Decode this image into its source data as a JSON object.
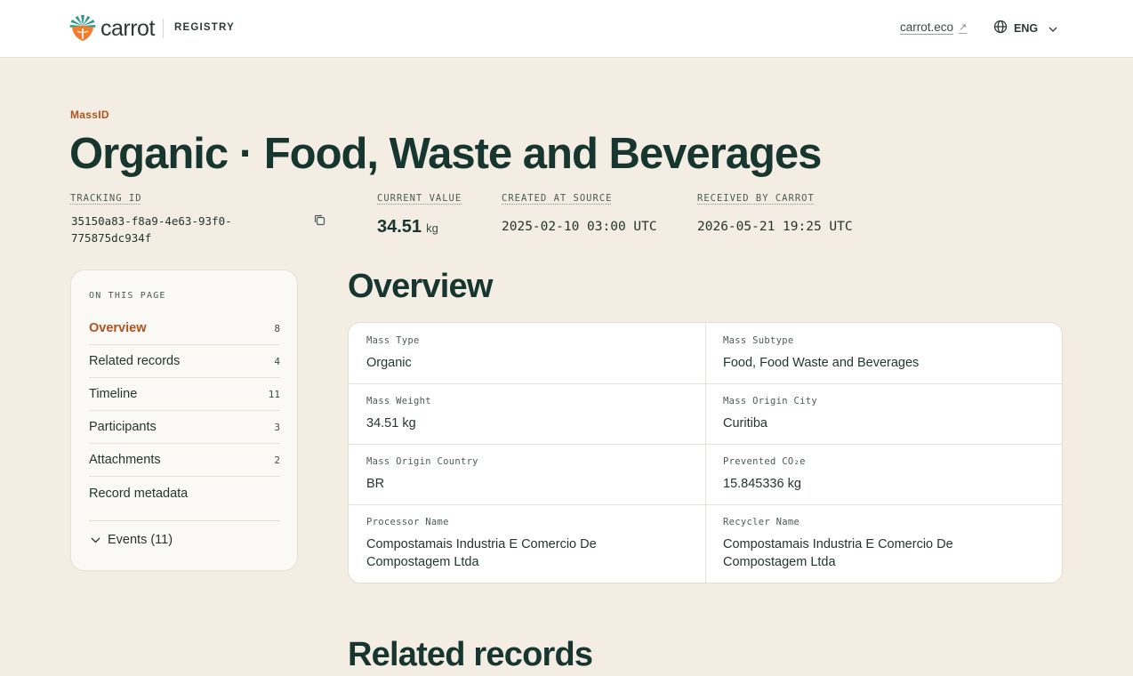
{
  "header": {
    "logo_text": "carrot",
    "logo_icon": "carrot-logo-icon",
    "section": "REGISTRY",
    "external_link": "carrot.eco",
    "external_icon": "arrow-up-right-icon",
    "language": "ENG",
    "language_icon": "globe-icon"
  },
  "record": {
    "eyebrow": "MassID",
    "title": "Organic · Food, Waste and Beverages",
    "tracking_id_label": "TRACKING ID",
    "tracking_id": "35150a83-f8a9-4e63-93f0-775875dc934f",
    "current_value_label": "CURRENT VALUE",
    "current_value": "34.51",
    "current_unit": "kg",
    "created_label": "CREATED AT SOURCE",
    "created_value": "2025-02-10 03:00 UTC",
    "received_label": "RECEIVED BY CARROT",
    "received_value": "2026-05-21 19:25 UTC"
  },
  "toc": {
    "heading": "ON THIS PAGE",
    "items": [
      {
        "label": "Overview",
        "count": "8"
      },
      {
        "label": "Related records",
        "count": "4"
      },
      {
        "label": "Timeline",
        "count": "11"
      },
      {
        "label": "Participants",
        "count": "3"
      },
      {
        "label": "Attachments",
        "count": "2"
      },
      {
        "label": "Record metadata",
        "count": ""
      }
    ],
    "events_label": "Events (11)"
  },
  "overview": {
    "title": "Overview",
    "fields": [
      {
        "label": "Mass Type",
        "value": "Organic"
      },
      {
        "label": "Mass Subtype",
        "value": "Food, Food Waste and Beverages"
      },
      {
        "label": "Mass Weight",
        "value": "34.51 kg"
      },
      {
        "label": "Mass Origin City",
        "value": "Curitiba"
      },
      {
        "label": "Mass Origin Country",
        "value": "BR"
      },
      {
        "label": "Prevented CO₂e",
        "value": "15.845336 kg"
      },
      {
        "label": "Processor Name",
        "value": "Compostamais Industria E Comercio De Compostagem Ltda"
      },
      {
        "label": "Recycler Name",
        "value": "Compostamais Industria E Comercio De Compostagem Ltda"
      }
    ]
  },
  "next_section": {
    "title": "Related records"
  },
  "colors": {
    "accent": "#b2511d",
    "ink": "#17362f",
    "background": "#f3ede3"
  }
}
